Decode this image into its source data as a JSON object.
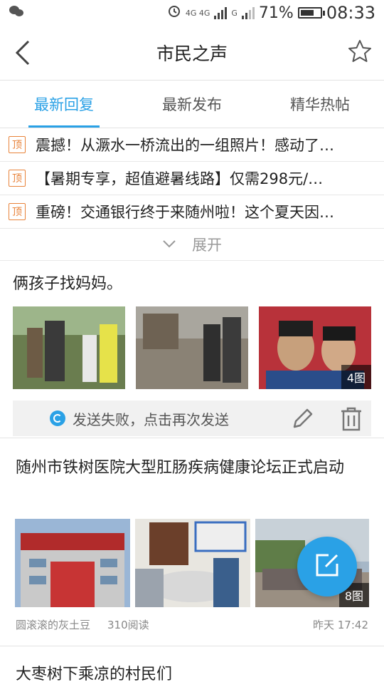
{
  "status": {
    "time": "08:33",
    "battery": "71%",
    "battery_level": 0.71,
    "signal1": "4G 4G",
    "signal2": "G"
  },
  "header": {
    "title": "市民之声"
  },
  "tabs": [
    {
      "label": "最新回复"
    },
    {
      "label": "最新发布"
    },
    {
      "label": "精华热帖"
    }
  ],
  "pinned": [
    {
      "badge": "顶",
      "text": "震撼！从㵐水一桥流出的一组照片！感动了…"
    },
    {
      "badge": "顶",
      "text": "【暑期专享，超值避暑线路】仅需298元/…"
    },
    {
      "badge": "顶",
      "text": "重磅！交通银行终于来随州啦！这个夏天因…"
    }
  ],
  "expand": {
    "label": "展开"
  },
  "post1": {
    "title": "俩孩子找妈妈。",
    "image_count": "4图",
    "fail_text": "发送失败，点击再次发送"
  },
  "post2": {
    "title": "随州市铁树医院大型肛肠疾病健康论坛正式启动",
    "image_count": "8图",
    "author": "圆滚滚的灰土豆",
    "reads": "310阅读",
    "time": "昨天 17:42"
  },
  "post3": {
    "title": "大枣树下乘凉的村民们"
  },
  "colors": {
    "accent": "#2aa1e6",
    "pin_badge": "#e8833a"
  }
}
